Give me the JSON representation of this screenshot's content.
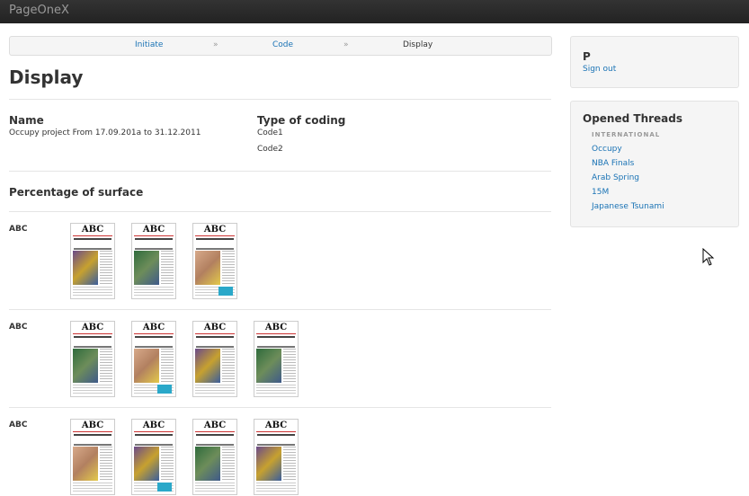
{
  "app": {
    "brand": "PageOneX"
  },
  "breadcrumb": {
    "items": [
      "Initiate",
      "Code",
      "Display"
    ],
    "separator": "»"
  },
  "page": {
    "title": "Display"
  },
  "info": {
    "name_label": "Name",
    "name_value": "Occupy project From 17.09.201a to 31.12.2011",
    "coding_label": "Type of coding",
    "codes": [
      "Code1",
      "Code2"
    ]
  },
  "section": {
    "title": "Percentage of surface"
  },
  "rows": [
    {
      "label": "ABC",
      "front_page_count": 3
    },
    {
      "label": "ABC",
      "front_page_count": 4
    },
    {
      "label": "ABC",
      "front_page_count": 4
    }
  ],
  "thumbnail": {
    "masthead": "ABC"
  },
  "account": {
    "username": "P",
    "sign_out": "Sign out"
  },
  "threads": {
    "title": "Opened Threads",
    "subtitle": "INTERNATIONAL",
    "items": [
      "Occupy",
      "NBA Finals",
      "Arab Spring",
      "15M",
      "Japanese Tsunami"
    ]
  },
  "colors": {
    "link": "#1a73b5",
    "topbar": "#222222",
    "panel": "#f5f5f5"
  }
}
